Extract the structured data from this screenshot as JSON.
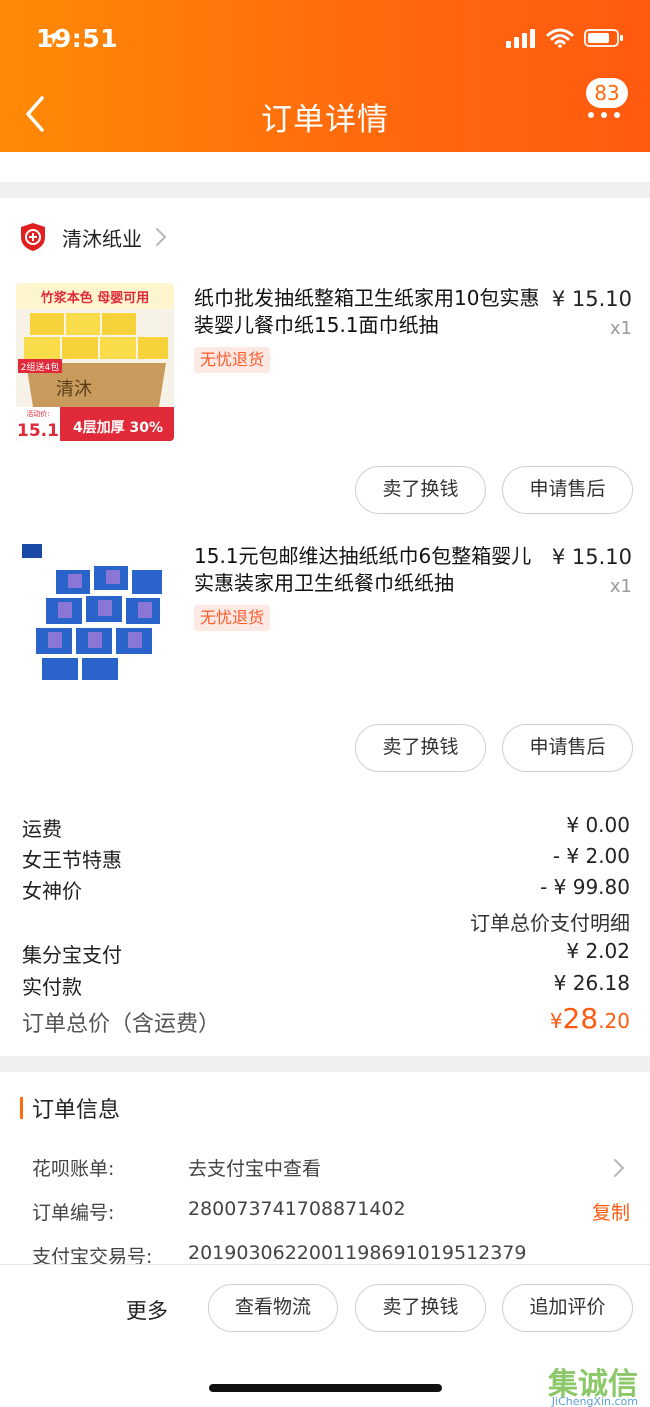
{
  "status_bar": {
    "time": "19:51"
  },
  "nav": {
    "title": "订单详情",
    "badge_count": "83"
  },
  "shop": {
    "name": "清沐纸业"
  },
  "products": [
    {
      "title": "纸巾批发抽纸整箱卫生纸家用10包实惠装婴儿餐巾纸15.1面巾纸抽",
      "price": "¥ 15.10",
      "qty": "x1",
      "tag": "无忧退货",
      "image_texts": {
        "top_banner": "竹浆本色 母婴可用",
        "promo": "2组送4包",
        "brand": "清沐",
        "price_small": "活动价:",
        "price_big": "15.1",
        "layers": "4层加厚 30%"
      },
      "buttons": [
        "卖了换钱",
        "申请售后"
      ]
    },
    {
      "title": "15.1元包邮维达抽纸纸巾6包整箱婴儿实惠装家用卫生纸餐巾纸纸抽",
      "price": "¥ 15.10",
      "qty": "x1",
      "tag": "无忧退货",
      "buttons": [
        "卖了换钱",
        "申请售后"
      ]
    }
  ],
  "costs": [
    {
      "label": "运费",
      "value": "¥ 0.00"
    },
    {
      "label": "女王节特惠",
      "value": "- ¥ 2.00"
    },
    {
      "label": "女神价",
      "value": "- ¥ 99.80"
    },
    {
      "label": "",
      "value": "订单总价支付明细"
    },
    {
      "label": "集分宝支付",
      "value": "¥ 2.02"
    },
    {
      "label": "实付款",
      "value": "¥ 26.18"
    }
  ],
  "total": {
    "label": "订单总价（含运费）",
    "currency": "¥",
    "integer": "28",
    "decimal": ".20"
  },
  "order_info": {
    "title": "订单信息",
    "rows": [
      {
        "key": "花呗账单:",
        "value": "去支付宝中查看",
        "action": ""
      },
      {
        "key": "订单编号:",
        "value": "280073741708871402",
        "action": "复制"
      },
      {
        "key": "支付宝交易号:",
        "value": "2019030622001198691019512379",
        "action": ""
      }
    ]
  },
  "bottom_bar": {
    "more": "更多",
    "buttons": [
      "查看物流",
      "卖了换钱",
      "追加评价"
    ]
  },
  "watermark": {
    "text": "集诚信",
    "url": "JiChengXin.com"
  },
  "colors": {
    "accent": "#ff6a0c",
    "price": "#ff5a10",
    "tag_bg": "#fde9e4",
    "gap": "#f0f0f0"
  }
}
